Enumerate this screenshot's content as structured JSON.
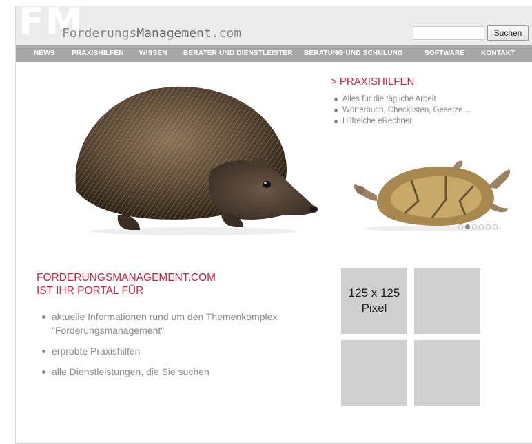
{
  "header": {
    "logo_mark": "FM",
    "logo_text_1": "Forderungs",
    "logo_text_2": "Management",
    "logo_text_3": ".com",
    "search_placeholder": "",
    "search_button": "Suchen"
  },
  "nav": {
    "items": [
      {
        "label": "NEWS"
      },
      {
        "label": "PRAXISHILFEN"
      },
      {
        "label": "WISSEN"
      },
      {
        "label": "BERATER UND DIENSTLEISTER"
      },
      {
        "label": "BERATUNG UND SCHULUNG"
      },
      {
        "label": "SOFTWARE"
      },
      {
        "label": "KONTAKT"
      }
    ]
  },
  "banner": {
    "title": "> PRAXISHILFEN",
    "bullets": [
      "Alles für die tägliche Arbeit",
      "Wörterbuch, Checklisten, Gesetze ...",
      "Hilfreiche eRechner"
    ],
    "slide_count": 6,
    "active_slide": 2
  },
  "portal": {
    "title_line1": "FORDERUNGSMANAGEMENT.COM",
    "title_line2": "IST IHR PORTAL FÜR",
    "bullets": [
      "aktuelle Informationen rund um den Themenkomplex \"Forderungsmanagement\"",
      "erprobte Praxishilfen",
      "alle Dienstleistungen, die Sie suchen"
    ]
  },
  "ads": {
    "label_line1": "125 x 125",
    "label_line2": "Pixel"
  },
  "colors": {
    "accent_red": "#c4253f",
    "nav_gray": "#a7a7a7",
    "header_gray": "#ececec",
    "ad_gray": "#cfcfcf"
  }
}
